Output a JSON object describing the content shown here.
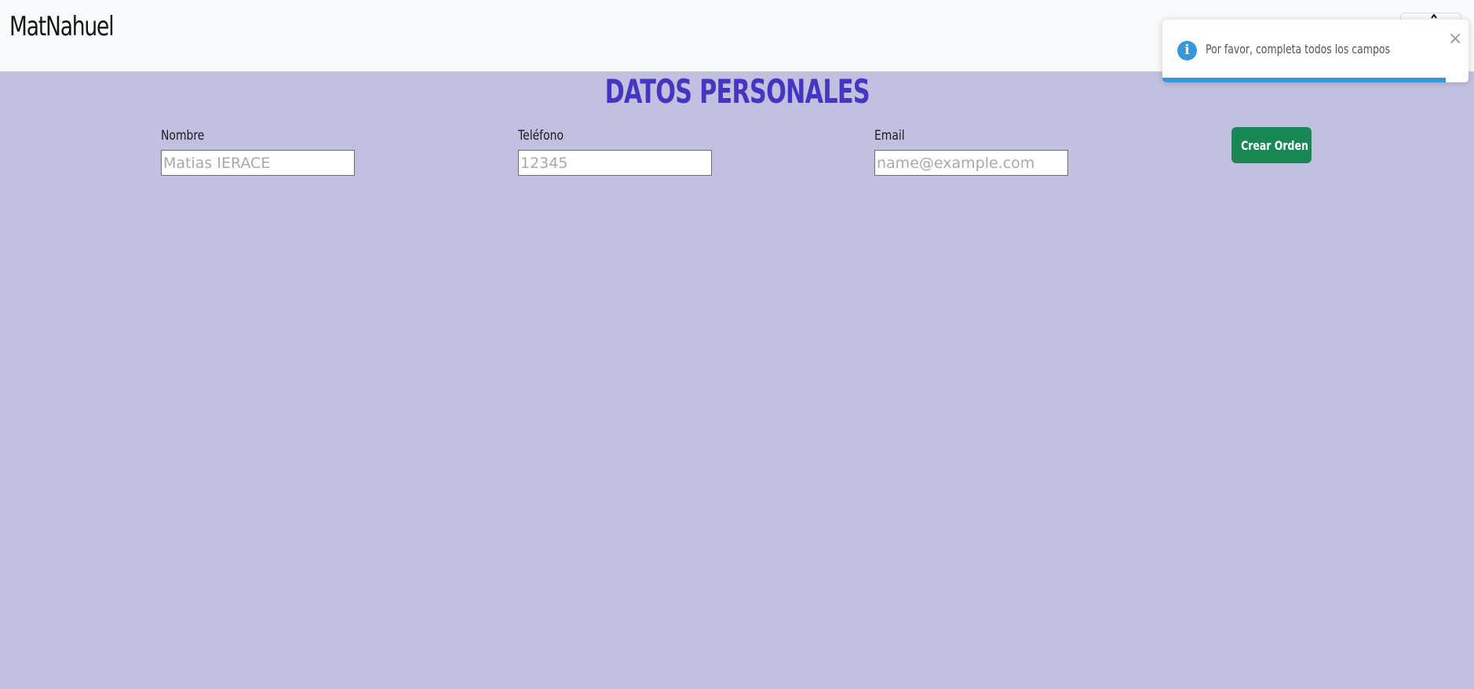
{
  "navbar": {
    "brand": "MatNahuel",
    "toggler_icon": "hamburger-menu-icon"
  },
  "main": {
    "title": "DATOS PERSONALES",
    "fields": {
      "name": {
        "label": "Nombre",
        "placeholder": "Matias IERACE"
      },
      "phone": {
        "label": "Teléfono",
        "placeholder": "12345"
      },
      "email": {
        "label": "Email",
        "placeholder": "name@example.com"
      }
    },
    "submit_label": "Crear Orden"
  },
  "toast": {
    "icon": "info-icon",
    "icon_glyph": "i",
    "message": "Por favor, completa todos los campos",
    "close_glyph": "×",
    "progress_fraction": 0.925
  },
  "colors": {
    "background": "#c2c0e0",
    "navbar": "#f8f9fa",
    "title": "#4436c0",
    "button": "#198754",
    "toast_accent": "#3498db"
  }
}
